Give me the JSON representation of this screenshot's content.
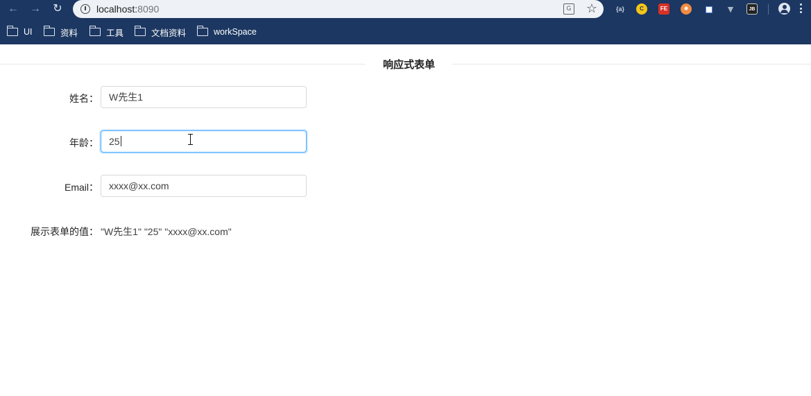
{
  "browser": {
    "url_host": "localhost:",
    "url_port": "8090",
    "bookmarks": [
      "UI",
      "资料",
      "工具",
      "文档资料",
      "workSpace"
    ]
  },
  "form": {
    "title": "响应式表单",
    "name_label": "姓名：",
    "name_value": "W先生1",
    "age_label": "年龄：",
    "age_value": "25",
    "email_label": "Email：",
    "email_placeholder": "xxxx@xx.com",
    "result_label": "展示表单的值：",
    "result_value": "\"W先生1\" \"25\" \"xxxx@xx.com\""
  },
  "colors": {
    "chrome_bg": "#1c3761",
    "focus_border": "#40a9ff",
    "input_border": "#d9d9d9"
  },
  "icons": {
    "back": "arrow-left-icon",
    "forward": "arrow-right-icon",
    "reload": "reload-icon",
    "info": "info-icon",
    "translate": "translate-icon",
    "bookmark": "star-icon",
    "profile": "avatar-icon",
    "menu": "more-vertical-icon",
    "folder": "folder-icon"
  }
}
